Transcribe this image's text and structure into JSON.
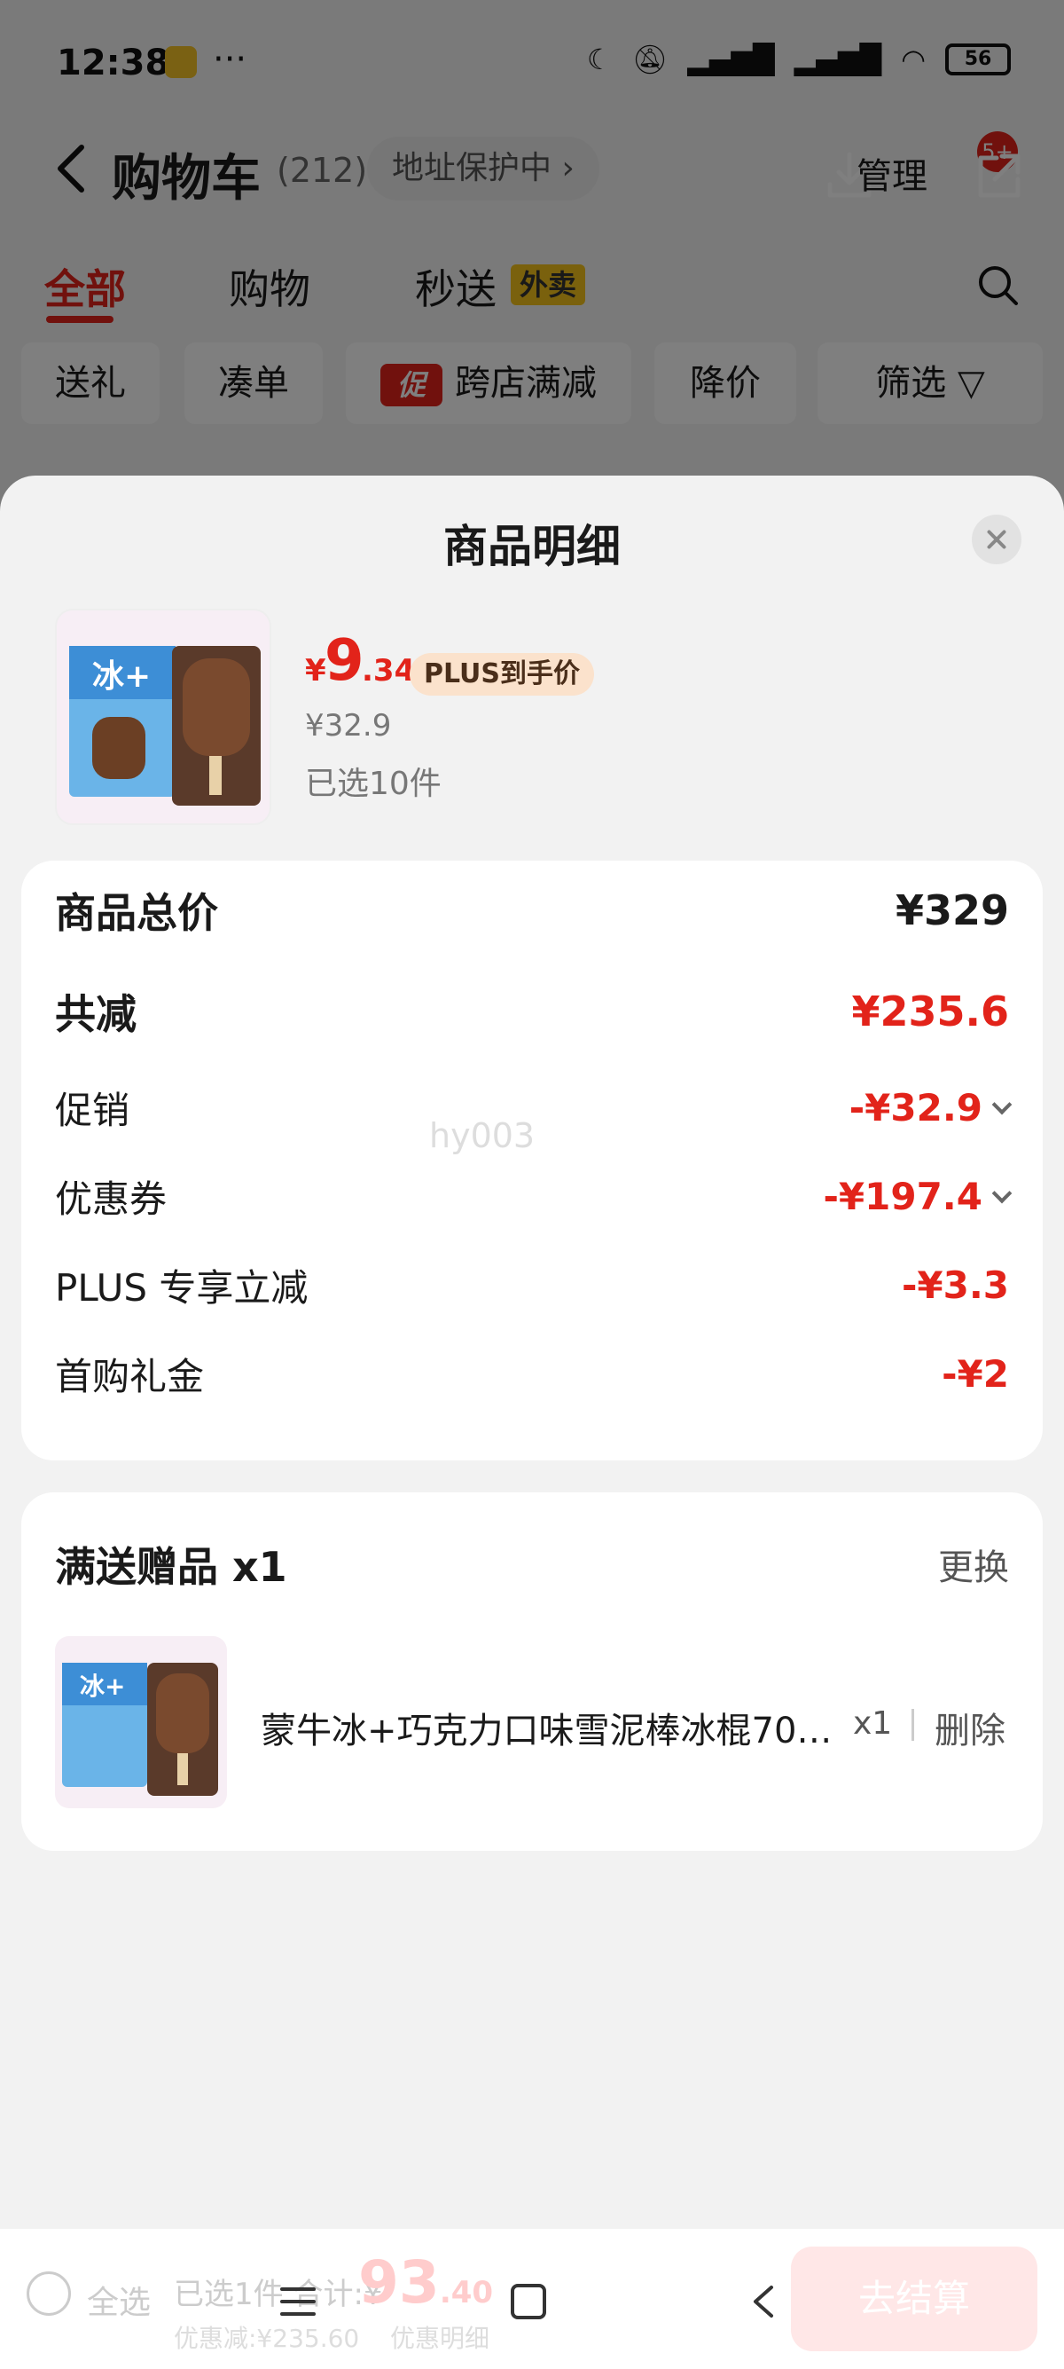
{
  "status_bar": {
    "time": "12:38",
    "more": "···",
    "battery": "56"
  },
  "header": {
    "title": "购物车",
    "count": "(212)",
    "address": "地址保护中 ›",
    "manage": "管理",
    "message_badge": "5+"
  },
  "tabs": [
    {
      "label": "全部"
    },
    {
      "label": "购物"
    },
    {
      "label": "秒送"
    }
  ],
  "tab_tag": "外卖",
  "filters": [
    {
      "label": "送礼"
    },
    {
      "label": "凑单"
    },
    {
      "label": "跨店满减",
      "tag": "促"
    },
    {
      "label": "降价"
    },
    {
      "label": "筛选"
    }
  ],
  "sheet": {
    "title": "商品明细",
    "product": {
      "price_symbol": "¥",
      "price_int": "9",
      "price_dec": ".34",
      "plus_tag": "PLUS到手价",
      "original_price": "¥32.9",
      "selected_qty": "已选10件"
    },
    "breakdown": {
      "total_label": "商品总价",
      "total_value": "¥329",
      "discount_label": "共减",
      "discount_value": "¥235.6",
      "items": [
        {
          "label": "促销",
          "value": "-¥32.9",
          "expandable": true
        },
        {
          "label": "优惠券",
          "value": "-¥197.4",
          "expandable": true
        },
        {
          "label": "PLUS 专享立减",
          "value": "-¥3.3",
          "expandable": false
        },
        {
          "label": "首购礼金",
          "value": "-¥2",
          "expandable": false
        }
      ],
      "watermark": "hy003"
    },
    "gift": {
      "title": "满送赠品 x1",
      "swap": "更换",
      "name": "蒙牛冰+巧克力口味雪泥棒冰棍70…",
      "qty": "x1",
      "delete": "删除"
    }
  },
  "bottom_bar": {
    "select_all": "全选",
    "selected_text": "已选1件 合计:¥",
    "total_price": "93",
    "total_price_dec": ".40",
    "discount_text": "优惠减:¥235.60",
    "detail_text": "优惠明细",
    "checkout": "去结算"
  },
  "colors": {
    "accent": "#e2231a",
    "plus_tag_bg": "#fbe2cc",
    "waimai_tag": "#f5c21a"
  }
}
